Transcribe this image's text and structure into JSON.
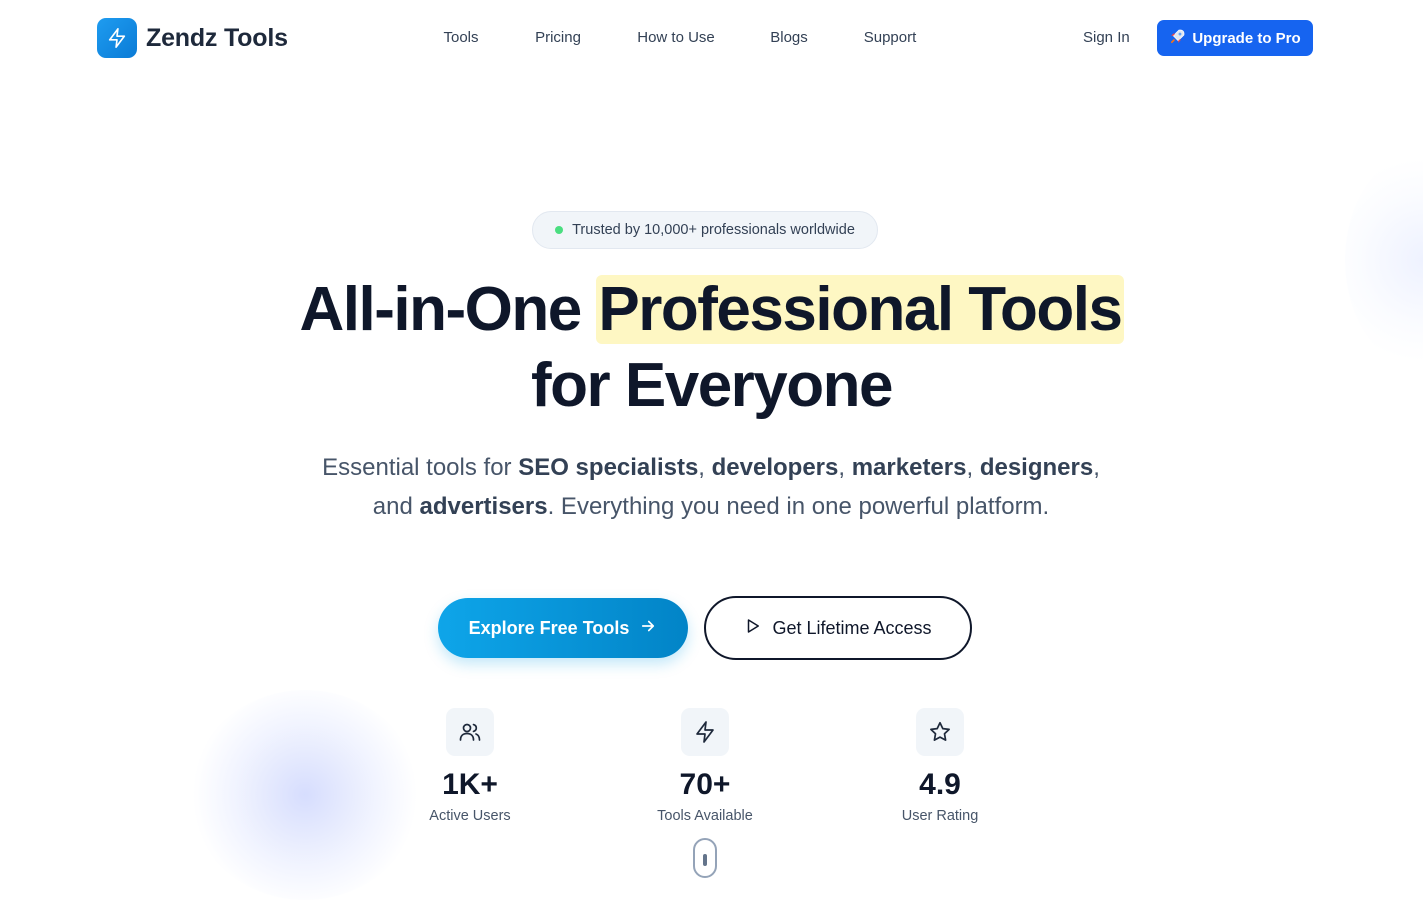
{
  "brand": {
    "name": "Zendz Tools",
    "icon": "lightning-bolt-icon",
    "color": "#1e9cf0"
  },
  "nav": {
    "links": [
      "Tools",
      "Pricing",
      "How to Use",
      "Blogs",
      "Support"
    ],
    "sign_in": "Sign In",
    "upgrade": "Upgrade to Pro",
    "upgrade_icon": "rocket-icon",
    "upgrade_color": "#1664f0"
  },
  "hero": {
    "badge": "Trusted by 10,000+ professionals worldwide",
    "headline_start": "All-in-One ",
    "headline_highlight": "Professional Tools",
    "headline_end": "for Everyone",
    "highlight_color": "#fef7c3",
    "subtitle": {
      "p1": "Essential tools for ",
      "b1": "SEO specialists",
      "p2": ", ",
      "b2": "developers",
      "p3": ", ",
      "b3": "marketers",
      "p4": ", ",
      "b4": "designers",
      "p5": ", and ",
      "b5": "advertisers",
      "p6": ". Everything you need in one powerful platform."
    },
    "cta_primary": "Explore Free Tools",
    "cta_secondary": "Get Lifetime Access"
  },
  "stats": [
    {
      "icon": "users-icon",
      "value": "1K+",
      "label": "Active Users"
    },
    {
      "icon": "lightning-bolt-icon",
      "value": "70+",
      "label": "Tools Available"
    },
    {
      "icon": "star-icon",
      "value": "4.9",
      "label": "User Rating"
    }
  ]
}
